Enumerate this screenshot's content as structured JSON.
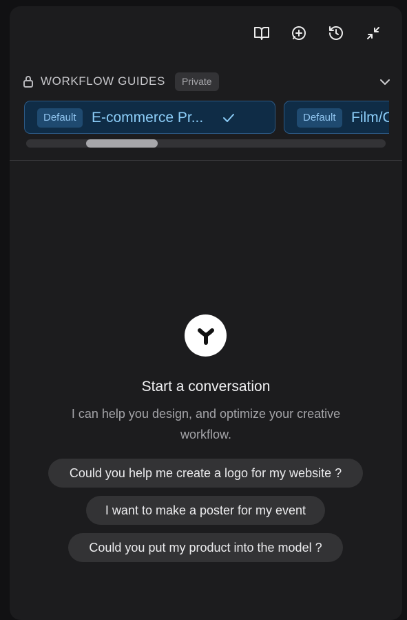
{
  "toolbar": {
    "icons": [
      "book-open-icon",
      "chat-plus-icon",
      "history-icon",
      "collapse-icon"
    ]
  },
  "guides": {
    "title": "WORKFLOW GUIDES",
    "privacy_badge": "Private",
    "cards": [
      {
        "badge": "Default",
        "name": "E-commerce Pr...",
        "selected": true
      },
      {
        "badge": "Default",
        "name": "Film/C",
        "selected": false
      }
    ]
  },
  "empty_state": {
    "title": "Start a conversation",
    "subtitle": "I can help you design, and optimize your creative workflow."
  },
  "suggestions": [
    "Could you help me create a logo for my website ?",
    "I want to make a poster for my event",
    "Could you put my product into the model ?"
  ],
  "colors": {
    "background": "#1c1c1e",
    "accent": "#8ccdf8",
    "card_bg": "#0f2c46"
  }
}
